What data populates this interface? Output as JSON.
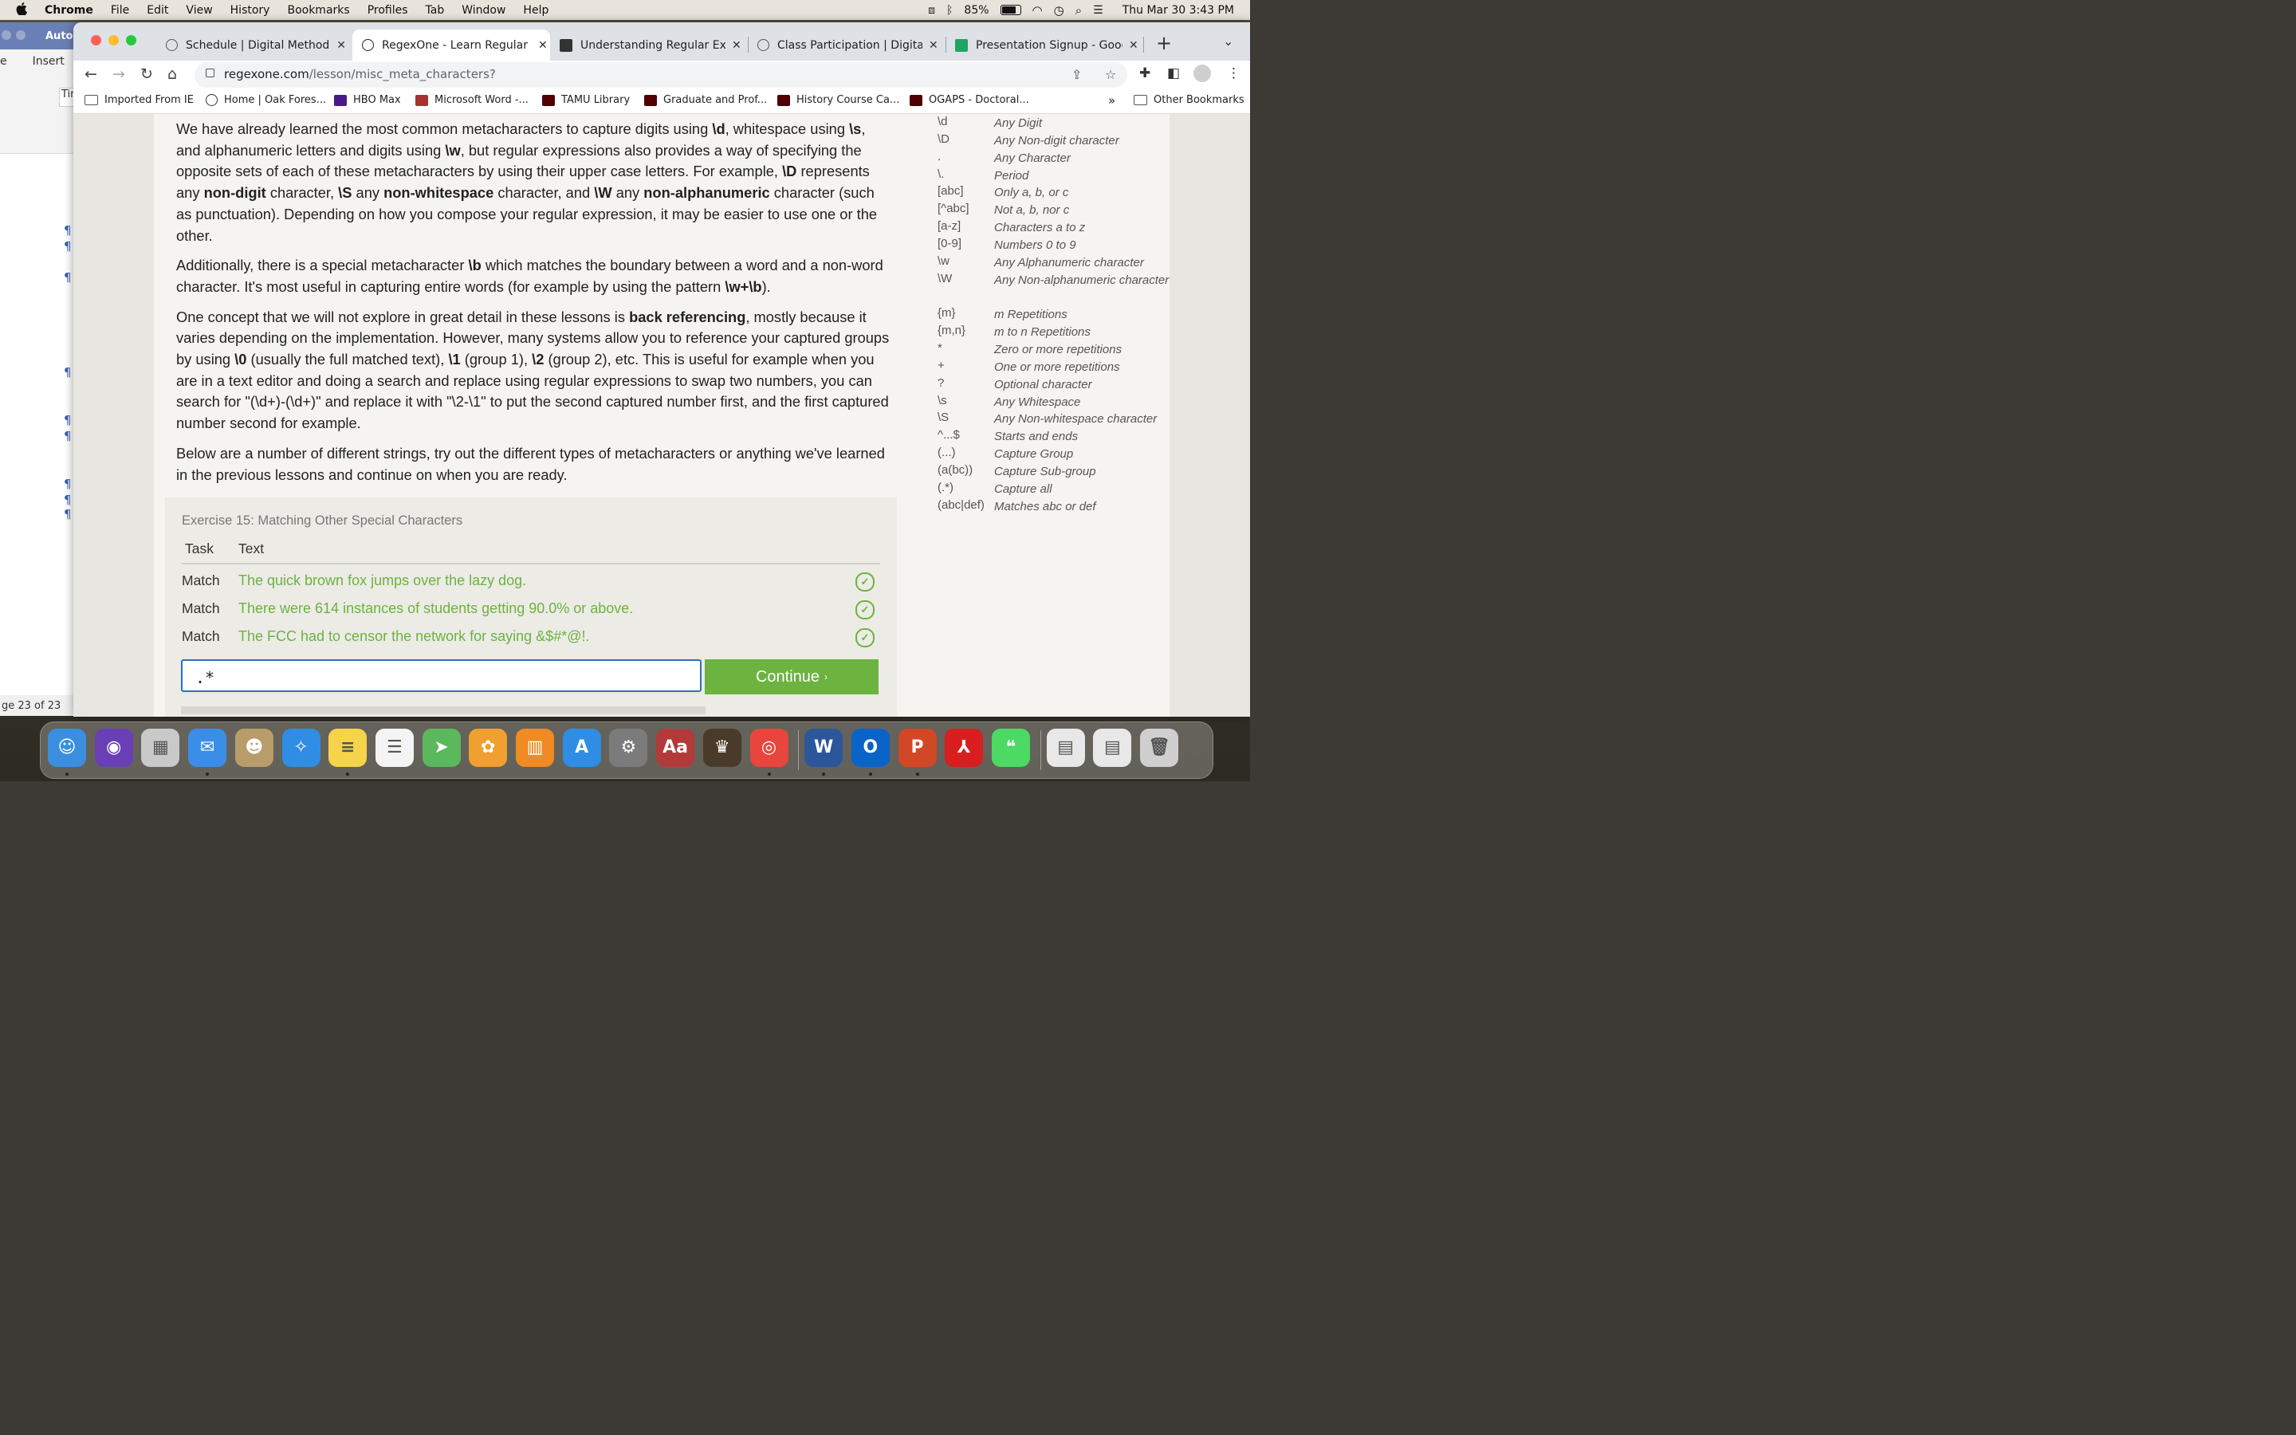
{
  "menubar": {
    "apple": "",
    "items": [
      "Chrome",
      "File",
      "Edit",
      "View",
      "History",
      "Bookmarks",
      "Profiles",
      "Tab",
      "Window",
      "Help"
    ],
    "battery": "85%",
    "datetime": "Thu Mar 30  3:43 PM"
  },
  "word": {
    "title": "AutoS",
    "tabs": [
      "e",
      "Insert"
    ],
    "font_box": "Tir",
    "status": "ge 23 of 23"
  },
  "tabs": [
    {
      "label": "Schedule | Digital Methods fo"
    },
    {
      "label": "RegexOne - Learn Regular Ex"
    },
    {
      "label": "Understanding Regular Expre"
    },
    {
      "label": "Class Participation | Digital M"
    },
    {
      "label": "Presentation Signup - Google"
    }
  ],
  "omnibox": {
    "host": "regexone.com",
    "path": "/lesson/misc_meta_characters?"
  },
  "bookmarks": [
    "Imported From IE",
    "Home | Oak Fores...",
    "HBO Max",
    "Microsoft Word -...",
    "TAMU Library",
    "Graduate and Prof...",
    "History Course Ca...",
    "OGAPS - Doctoral...",
    "Other Bookmarks"
  ],
  "lesson": {
    "p1": [
      {
        "t": "We have already learned the most common metacharacters to capture digits using "
      },
      {
        "b": "\\d"
      },
      {
        "t": ", whitespace using "
      },
      {
        "b": "\\s"
      },
      {
        "t": ", and alphanumeric letters and digits using "
      },
      {
        "b": "\\w"
      },
      {
        "t": ", but regular expressions also provides a way of specifying the opposite sets of each of these metacharacters by using their upper case letters. For example, "
      },
      {
        "b": "\\D"
      },
      {
        "t": " represents any "
      },
      {
        "b": "non-digit"
      },
      {
        "t": " character, "
      },
      {
        "b": "\\S"
      },
      {
        "t": " any "
      },
      {
        "b": "non-whitespace"
      },
      {
        "t": " character, and "
      },
      {
        "b": "\\W"
      },
      {
        "t": " any "
      },
      {
        "b": "non-alphanumeric"
      },
      {
        "t": " character (such as punctuation). Depending on how you compose your regular expression, it may be easier to use one or the other."
      }
    ],
    "p2": [
      {
        "t": "Additionally, there is a special metacharacter "
      },
      {
        "b": "\\b"
      },
      {
        "t": " which matches the boundary between a word and a non-word character. It's most useful in capturing entire words (for example by using the pattern "
      },
      {
        "b": "\\w+\\b"
      },
      {
        "t": ")."
      }
    ],
    "p3": [
      {
        "t": "One concept that we will not explore in great detail in these lessons is "
      },
      {
        "b": "back referencing"
      },
      {
        "t": ", mostly because it varies depending on the implementation. However, many systems allow you to reference your captured groups by using "
      },
      {
        "b": "\\0"
      },
      {
        "t": " (usually the full matched text), "
      },
      {
        "b": "\\1"
      },
      {
        "t": " (group 1), "
      },
      {
        "b": "\\2"
      },
      {
        "t": " (group 2), etc. This is useful for example when you are in a text editor and doing a search and replace using regular expressions to swap two numbers, you can search for \"(\\d+)-(\\d+)\" and replace it with \"\\2-\\1\" to put the second captured number first, and the first captured number second for example."
      }
    ],
    "p4": [
      {
        "t": "Below are a number of different strings, try out the different types of metacharacters or anything we've learned in the previous lessons and continue on when you are ready."
      }
    ]
  },
  "exercise": {
    "title": "Exercise 15: Matching Other Special Characters",
    "col_task": "Task",
    "col_text": "Text",
    "rows": [
      {
        "task": "Match",
        "text": "The quick brown fox jumps over the lazy dog.",
        "check": "✓"
      },
      {
        "task": "Match",
        "text": "There were 614 instances of students getting 90.0% or above.",
        "check": "✓"
      },
      {
        "task": "Match",
        "text": "The FCC had to censor the network for saying &$#*@!.",
        "check": "✓"
      }
    ],
    "input_value": ".*",
    "continue_label": "Continue",
    "continue_chevron": "›"
  },
  "cheatsheet": [
    {
      "sym": "\\d",
      "desc": "Any Digit"
    },
    {
      "sym": "\\D",
      "desc": "Any Non-digit character"
    },
    {
      "sym": ".",
      "desc": "Any Character"
    },
    {
      "sym": "\\.",
      "desc": "Period"
    },
    {
      "sym": "[abc]",
      "desc": "Only a, b, or c"
    },
    {
      "sym": "[^abc]",
      "desc": "Not a, b, nor c"
    },
    {
      "sym": "[a-z]",
      "desc": "Characters a to z"
    },
    {
      "sym": "[0-9]",
      "desc": "Numbers 0 to 9"
    },
    {
      "sym": "\\w",
      "desc": "Any Alphanumeric character"
    },
    {
      "sym": "\\W",
      "desc": "Any Non-alphanumeric character"
    },
    {
      "sym": "{m}",
      "desc": "m Repetitions"
    },
    {
      "sym": "{m,n}",
      "desc": "m to n Repetitions"
    },
    {
      "sym": "*",
      "desc": "Zero or more repetitions"
    },
    {
      "sym": "+",
      "desc": "One or more repetitions"
    },
    {
      "sym": "?",
      "desc": "Optional character"
    },
    {
      "sym": "\\s",
      "desc": "Any Whitespace"
    },
    {
      "sym": "\\S",
      "desc": "Any Non-whitespace character"
    },
    {
      "sym": "^...$",
      "desc": "Starts and ends"
    },
    {
      "sym": "(...)",
      "desc": "Capture Group"
    },
    {
      "sym": "(a(bc))",
      "desc": "Capture Sub-group"
    },
    {
      "sym": "(.*)",
      "desc": "Capture all"
    },
    {
      "sym": "(abc|def)",
      "desc": "Matches abc or def"
    }
  ],
  "dock": [
    {
      "name": "finder-icon",
      "glyph": "☺",
      "color": "#3a8fe0",
      "running": true
    },
    {
      "name": "siri-icon",
      "glyph": "◉",
      "color": "#6a3fb5",
      "running": false
    },
    {
      "name": "launchpad-icon",
      "glyph": "▦",
      "color": "#c9c9c9",
      "running": false
    },
    {
      "name": "mail-icon",
      "glyph": "✉",
      "color": "#3a8ee8",
      "running": true
    },
    {
      "name": "contacts-icon",
      "glyph": "☻",
      "color": "#b89c6a",
      "running": false
    },
    {
      "name": "safari-icon",
      "glyph": "✧",
      "color": "#2f8de4",
      "running": false
    },
    {
      "name": "notes-icon",
      "glyph": "≡",
      "color": "#f5d44a",
      "running": true
    },
    {
      "name": "reminders-icon",
      "glyph": "☰",
      "color": "#f4f4f4",
      "running": false
    },
    {
      "name": "maps-icon",
      "glyph": "➤",
      "color": "#5cb85c",
      "running": false
    },
    {
      "name": "photos-icon",
      "glyph": "✿",
      "color": "#f0a030",
      "running": false
    },
    {
      "name": "books-icon",
      "glyph": "▥",
      "color": "#f08a24",
      "running": false
    },
    {
      "name": "app-store-icon",
      "glyph": "A",
      "color": "#2f8de4",
      "running": false
    },
    {
      "name": "system-settings-icon",
      "glyph": "⚙",
      "color": "#7b7b7b",
      "running": false
    },
    {
      "name": "dictionary-icon",
      "glyph": "Aa",
      "color": "#b33a3a",
      "running": false
    },
    {
      "name": "medieval-game-icon",
      "glyph": "♛",
      "color": "#4a3a2a",
      "running": false
    },
    {
      "name": "chrome-icon",
      "glyph": "◎",
      "color": "#e8453c",
      "running": true
    },
    {
      "name": "word-icon",
      "glyph": "W",
      "color": "#2b579a",
      "running": true
    },
    {
      "name": "outlook-icon",
      "glyph": "O",
      "color": "#0a64c8",
      "running": true
    },
    {
      "name": "powerpoint-icon",
      "glyph": "P",
      "color": "#d24726",
      "running": true
    },
    {
      "name": "acrobat-icon",
      "glyph": "⅄",
      "color": "#d81e1e",
      "running": false
    },
    {
      "name": "messages-icon",
      "glyph": "❝",
      "color": "#4cd964",
      "running": false
    },
    {
      "name": "word-doc-thumb-1-icon",
      "glyph": "▤",
      "color": "#e8e8e8",
      "running": false
    },
    {
      "name": "word-doc-thumb-2-icon",
      "glyph": "▤",
      "color": "#e8e8e8",
      "running": false
    },
    {
      "name": "trash-icon",
      "glyph": "🗑",
      "color": "#cfcfcf",
      "running": false
    }
  ],
  "colors": {
    "accent_green": "#6cb33f",
    "input_border": "#2f6fc0"
  }
}
